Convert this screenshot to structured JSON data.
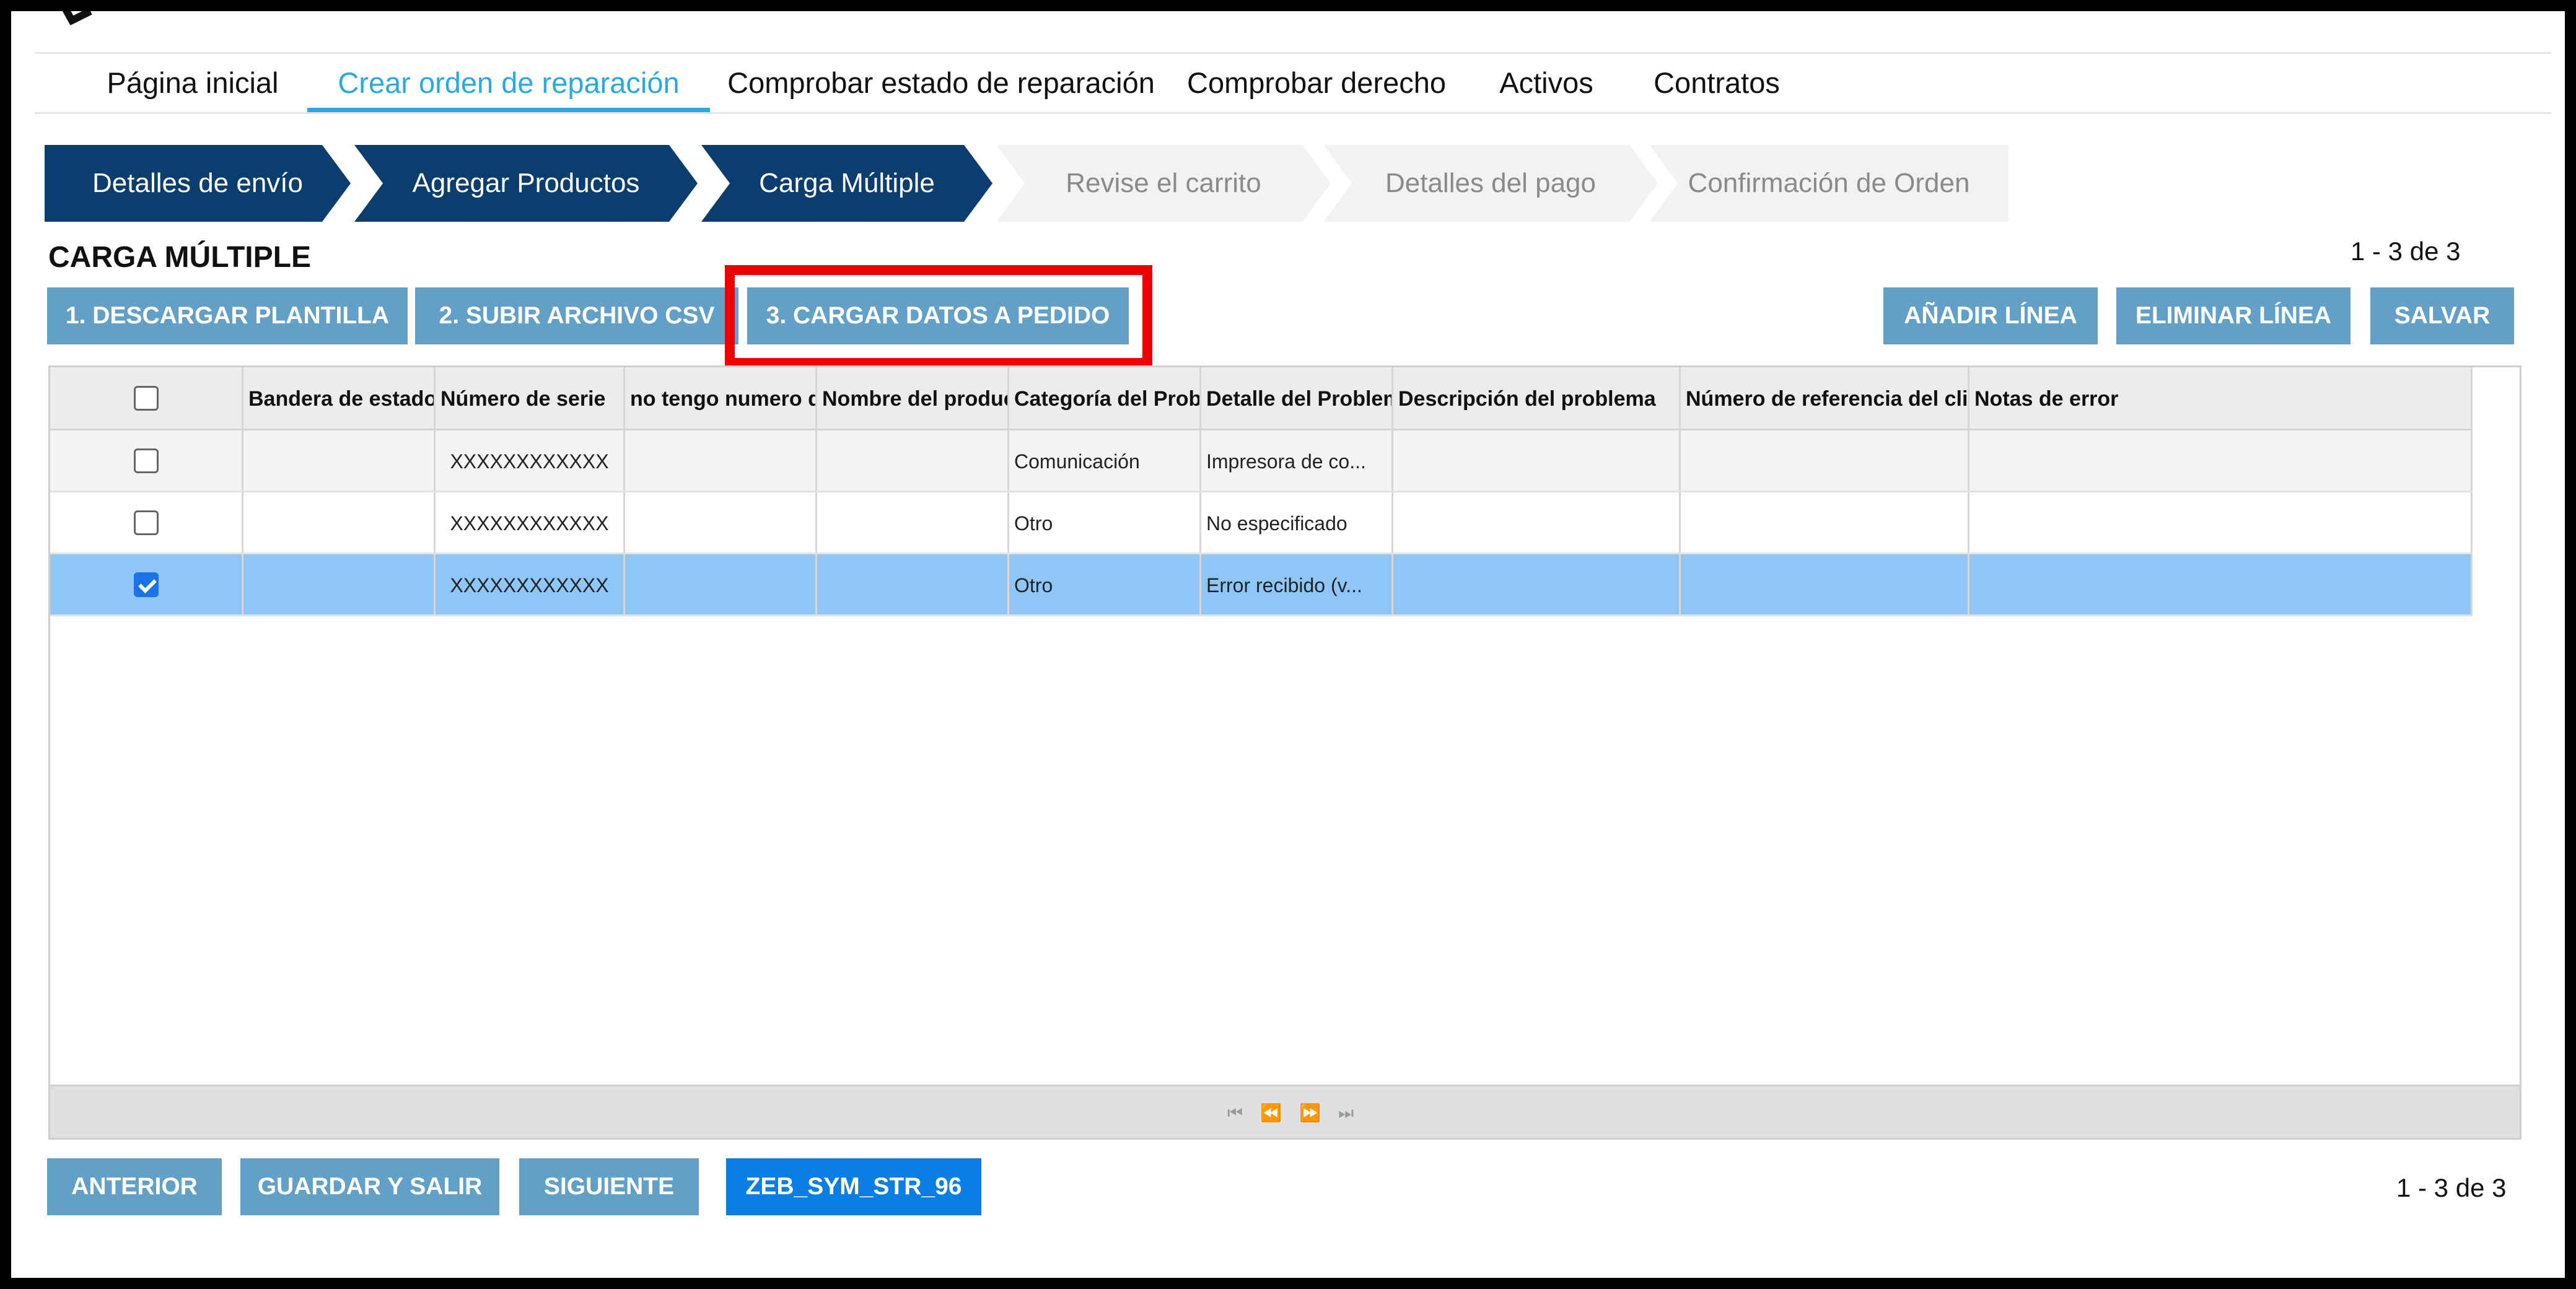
{
  "top_nav": {
    "items": [
      {
        "label": "Página inicial"
      },
      {
        "label": "Crear orden de reparación",
        "active": true
      },
      {
        "label": "Comprobar estado de reparación"
      },
      {
        "label": "Comprobar derecho"
      },
      {
        "label": "Activos"
      },
      {
        "label": "Contratos"
      }
    ]
  },
  "wizard": {
    "steps": [
      {
        "label": "Detalles de envío",
        "state": "done"
      },
      {
        "label": "Agregar Productos",
        "state": "done"
      },
      {
        "label": "Carga Múltiple",
        "state": "current"
      },
      {
        "label": "Revise el carrito",
        "state": "todo"
      },
      {
        "label": "Detalles del pago",
        "state": "todo"
      },
      {
        "label": "Confirmación de Orden",
        "state": "todo"
      }
    ]
  },
  "section": {
    "title": "CARGA MÚLTIPLE",
    "pager_top": "1 - 3 de 3",
    "pager_bottom": "1 - 3 de 3"
  },
  "toolbar": {
    "download_template": "1. DESCARGAR PLANTILLA",
    "upload_csv": "2. SUBIR ARCHIVO CSV",
    "load_to_order": "3. CARGAR DATOS A PEDIDO",
    "add_line": "AÑADIR LÍNEA",
    "delete_line": "ELIMINAR LÍNEA",
    "save": "SALVAR"
  },
  "grid": {
    "columns": [
      "",
      "Bandera de estado",
      "Número de serie",
      "no tengo numero de serie",
      "Nombre del producto",
      "Categoría del Problema",
      "Detalle del Problema",
      "Descripción del problema",
      "Número de referencia del cliente",
      "Notas de error"
    ],
    "rows": [
      {
        "checked": false,
        "cells": [
          "",
          "XXXXXXXXXXXX",
          "",
          "",
          "Comunicación",
          "Impresora de co...",
          "",
          "",
          ""
        ]
      },
      {
        "checked": false,
        "cells": [
          "",
          "XXXXXXXXXXXX",
          "",
          "",
          "Otro",
          "No especificado",
          "",
          "",
          ""
        ]
      },
      {
        "checked": true,
        "cells": [
          "",
          "XXXXXXXXXXXX",
          "",
          "",
          "Otro",
          "Error recibido (v...",
          "",
          "",
          ""
        ]
      }
    ]
  },
  "footer": {
    "previous": "ANTERIOR",
    "save_exit": "GUARDAR Y SALIR",
    "next": "SIGUIENTE",
    "code": "ZEB_SYM_STR_96"
  },
  "colors": {
    "accent": "#2aa9df",
    "wizard_done": "#0b3e6f",
    "button": "#62a0c8",
    "button_primary": "#0a7ee3",
    "selected_row": "#8ec7f7",
    "highlight": "#ee0000"
  },
  "icons": [
    "first-page-icon",
    "previous-page-icon",
    "next-page-icon",
    "last-page-icon",
    "checkbox-icon"
  ]
}
